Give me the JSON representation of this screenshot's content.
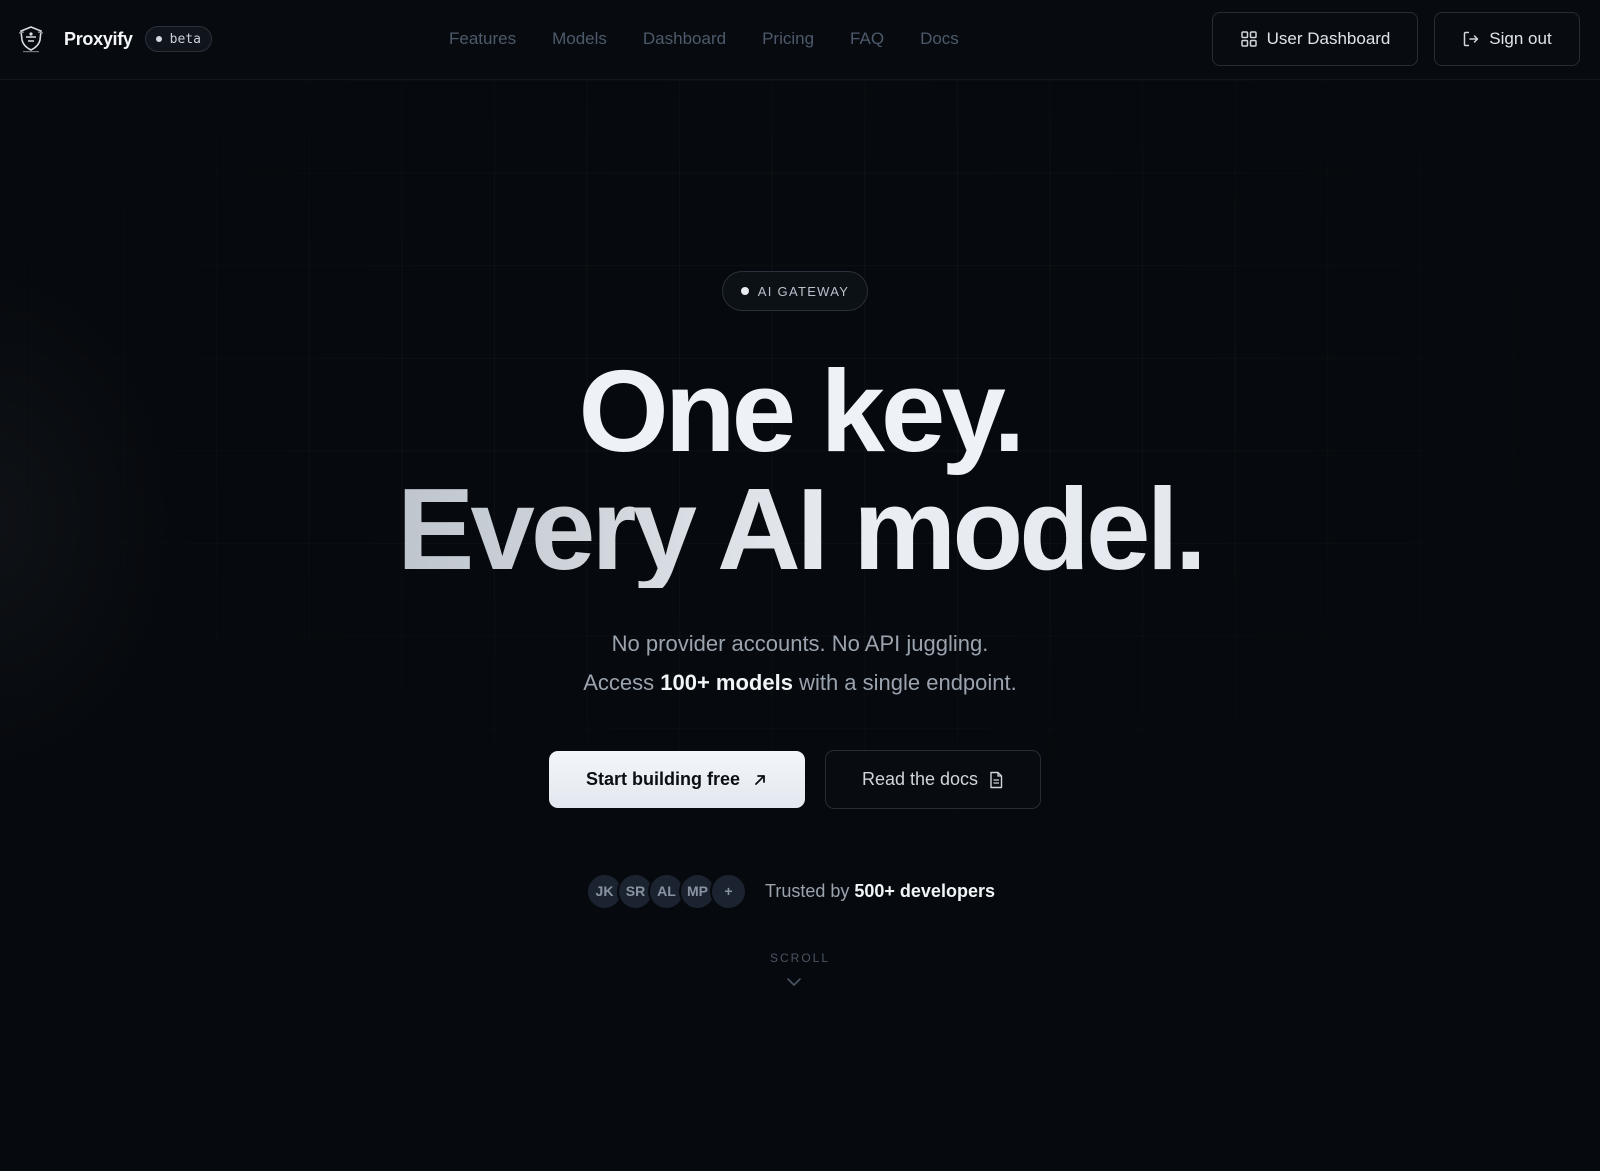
{
  "header": {
    "brand_name": "Proxyify",
    "beta_label": "beta",
    "nav": [
      {
        "label": "Features"
      },
      {
        "label": "Models"
      },
      {
        "label": "Dashboard"
      },
      {
        "label": "Pricing"
      },
      {
        "label": "FAQ"
      },
      {
        "label": "Docs"
      }
    ],
    "dashboard_button": "User Dashboard",
    "signout_button": "Sign out"
  },
  "hero": {
    "pill_label": "AI GATEWAY",
    "headline_line1": "One key.",
    "headline_line2": "Every AI model.",
    "sub_line1": "No provider accounts. No API juggling.",
    "sub_line2_prefix": "Access ",
    "sub_line2_bold": "100+ models",
    "sub_line2_suffix": " with a single endpoint.",
    "cta_primary": "Start building free",
    "cta_secondary": "Read the docs",
    "avatars": [
      "JK",
      "SR",
      "AL",
      "MP",
      "+"
    ],
    "trusted_prefix": "Trusted by ",
    "trusted_bold": "500+ developers",
    "scroll_label": "SCROLL"
  },
  "icons": {
    "logo": "shield-logo-icon",
    "dashboard": "grid-icon",
    "signout": "sign-out-icon",
    "cta_primary": "arrow-up-right-icon",
    "cta_secondary": "document-icon",
    "scroll": "chevron-down-icon"
  },
  "colors": {
    "background": "#06090d",
    "text_primary": "#eef2f6",
    "text_muted": "#9aa3ae",
    "nav_text": "#4d5a6b",
    "border": "#262d36",
    "cta_bg": "#eef2f7"
  }
}
